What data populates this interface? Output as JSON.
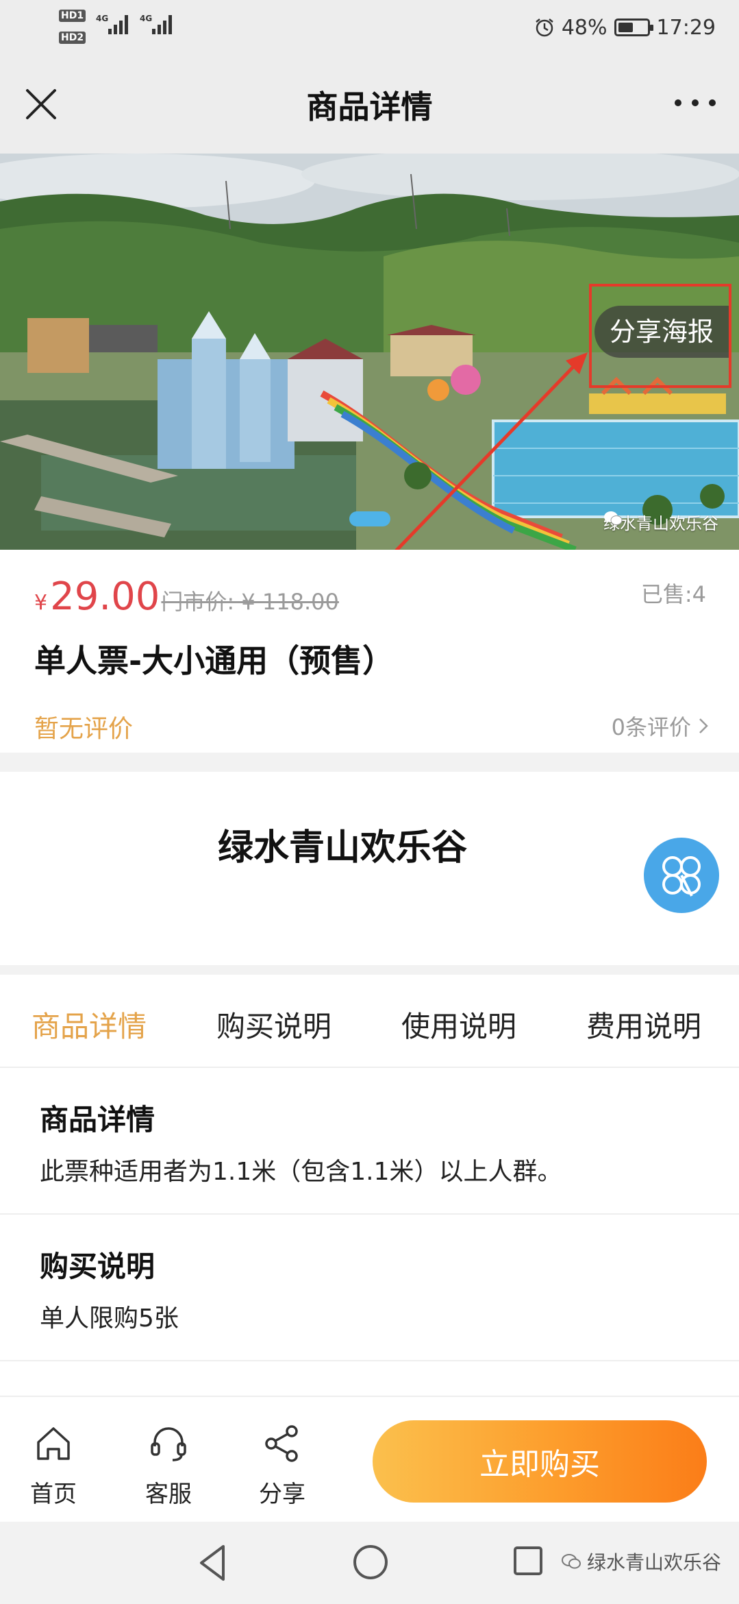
{
  "status_bar": {
    "hd1": "HD1",
    "hd2": "HD2",
    "net1": "4G",
    "net2": "4G",
    "battery": "48%",
    "time": "17:29",
    "icons": [
      "alarm-icon",
      "battery-icon",
      "signal-icon"
    ]
  },
  "nav": {
    "title": "商品详情",
    "icons": [
      "close-icon",
      "more-icon"
    ]
  },
  "banner": {
    "share_poster": "分享海报",
    "watermark": "绿水青山欢乐谷",
    "highlight_color": "#e53a2a"
  },
  "product": {
    "price_symbol": "¥",
    "price": "29.00",
    "market_price": "门市价: ¥ 118.00",
    "sold": "已售:4",
    "title": "单人票-大小通用（预售）",
    "no_review": "暂无评价",
    "review_count": "0条评价"
  },
  "store": {
    "name": "绿水青山欢乐谷"
  },
  "tabs": [
    {
      "label": "商品详情"
    },
    {
      "label": "购买说明"
    },
    {
      "label": "使用说明"
    },
    {
      "label": "费用说明"
    }
  ],
  "details": {
    "title": "商品详情",
    "body": "此票种适用者为1.1米（包含1.1米）以上人群。"
  },
  "purchase": {
    "title": "购买说明",
    "body": "单人限购5张"
  },
  "actions": {
    "home": "首页",
    "service": "客服",
    "share": "分享",
    "buy": "立即购买"
  },
  "footer": {
    "watermark": "绿水青山欢乐谷"
  },
  "colors": {
    "accent": "#e4a34a",
    "price": "#e0454a",
    "buy_start": "#fbc04d",
    "buy_end": "#fb7d18"
  }
}
